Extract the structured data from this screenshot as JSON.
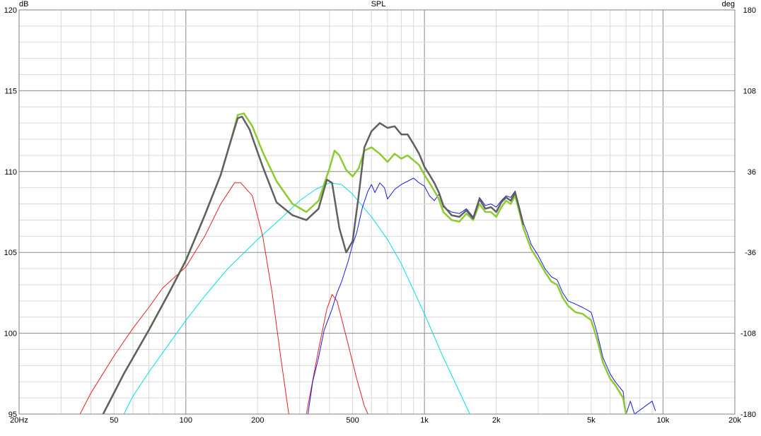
{
  "chart_data": {
    "type": "line",
    "title": "SPL",
    "ylabel_left": "dB",
    "ylabel_right": "deg",
    "x_scale": "log",
    "xlim": [
      20,
      20000
    ],
    "ylim": [
      95,
      120
    ],
    "y2lim": [
      -180,
      180
    ],
    "grid": true,
    "x_ticks": [
      {
        "v": 20,
        "label": "20Hz"
      },
      {
        "v": 50,
        "label": "50"
      },
      {
        "v": 100,
        "label": "100"
      },
      {
        "v": 200,
        "label": "200"
      },
      {
        "v": 500,
        "label": "500"
      },
      {
        "v": 1000,
        "label": "1k"
      },
      {
        "v": 2000,
        "label": "2k"
      },
      {
        "v": 5000,
        "label": "5k"
      },
      {
        "v": 10000,
        "label": "10k"
      },
      {
        "v": 20000,
        "label": "20k"
      }
    ],
    "y_ticks": [
      {
        "v": 95,
        "label": "95"
      },
      {
        "v": 100,
        "label": "100"
      },
      {
        "v": 105,
        "label": "105"
      },
      {
        "v": 110,
        "label": "110"
      },
      {
        "v": 115,
        "label": "115"
      },
      {
        "v": 120,
        "label": "120"
      }
    ],
    "y2_ticks": [
      {
        "v": -180,
        "label": "-180"
      },
      {
        "v": -108,
        "label": "-108"
      },
      {
        "v": -36,
        "label": "-36"
      },
      {
        "v": 36,
        "label": "36"
      },
      {
        "v": 108,
        "label": "108"
      },
      {
        "v": 180,
        "label": "180"
      }
    ],
    "series": [
      {
        "color": "#00e0e8",
        "width": 1,
        "points": [
          [
            55,
            95
          ],
          [
            60,
            96.1
          ],
          [
            70,
            97.6
          ],
          [
            80,
            98.8
          ],
          [
            100,
            100.8
          ],
          [
            120,
            102.3
          ],
          [
            150,
            104
          ],
          [
            200,
            105.8
          ],
          [
            250,
            107.1
          ],
          [
            300,
            108.2
          ],
          [
            350,
            108.9
          ],
          [
            400,
            109.3
          ],
          [
            450,
            109.2
          ],
          [
            500,
            108.6
          ],
          [
            600,
            107.2
          ],
          [
            700,
            105.8
          ],
          [
            800,
            104.3
          ],
          [
            1000,
            101.2
          ],
          [
            1200,
            98.5
          ],
          [
            1400,
            96.4
          ],
          [
            1550,
            95
          ]
        ]
      },
      {
        "color": "#e82020",
        "width": 1,
        "points": [
          [
            36,
            95
          ],
          [
            40,
            96.3
          ],
          [
            50,
            98.6
          ],
          [
            60,
            100.3
          ],
          [
            70,
            101.6
          ],
          [
            80,
            102.8
          ],
          [
            100,
            104.1
          ],
          [
            120,
            106
          ],
          [
            140,
            108
          ],
          [
            160,
            109.3
          ],
          [
            170,
            109.3
          ],
          [
            190,
            108.5
          ],
          [
            210,
            106
          ],
          [
            230,
            102.5
          ],
          [
            250,
            98.5
          ],
          [
            270,
            95
          ]
        ]
      },
      {
        "color": "#e82020",
        "width": 1,
        "points": [
          [
            320,
            95
          ],
          [
            360,
            99
          ],
          [
            390,
            101.5
          ],
          [
            410,
            102.4
          ],
          [
            430,
            102
          ],
          [
            470,
            99.8
          ],
          [
            520,
            97.2
          ],
          [
            560,
            95.5
          ],
          [
            580,
            95
          ]
        ]
      },
      {
        "color": "#1a1ae0",
        "width": 1,
        "points": [
          [
            325,
            95
          ],
          [
            340,
            97
          ],
          [
            360,
            98.5
          ],
          [
            380,
            100.2
          ],
          [
            410,
            101.5
          ],
          [
            430,
            102.5
          ],
          [
            450,
            103.2
          ],
          [
            480,
            104.5
          ],
          [
            500,
            105.5
          ],
          [
            520,
            106.2
          ],
          [
            550,
            107.8
          ],
          [
            580,
            108.8
          ],
          [
            600,
            109.2
          ],
          [
            620,
            108.7
          ],
          [
            650,
            109.3
          ],
          [
            680,
            109
          ],
          [
            700,
            108.3
          ],
          [
            750,
            108.9
          ],
          [
            800,
            109.2
          ],
          [
            850,
            109.4
          ],
          [
            900,
            109.6
          ],
          [
            950,
            109.3
          ],
          [
            1000,
            109.1
          ],
          [
            1050,
            108.5
          ],
          [
            1100,
            108.2
          ],
          [
            1150,
            108.6
          ],
          [
            1200,
            107.8
          ],
          [
            1300,
            107.5
          ],
          [
            1400,
            107.4
          ],
          [
            1500,
            107.7
          ],
          [
            1600,
            107.2
          ],
          [
            1700,
            108.4
          ],
          [
            1800,
            107.9
          ],
          [
            1900,
            108
          ],
          [
            2000,
            107.8
          ],
          [
            2100,
            108.2
          ],
          [
            2200,
            108.5
          ],
          [
            2300,
            108.4
          ],
          [
            2400,
            108.8
          ],
          [
            2500,
            107.8
          ],
          [
            2600,
            106.8
          ],
          [
            2700,
            106.2
          ],
          [
            2800,
            105.5
          ],
          [
            3000,
            104.8
          ],
          [
            3200,
            104
          ],
          [
            3400,
            103.5
          ],
          [
            3600,
            103.3
          ],
          [
            3800,
            102.5
          ],
          [
            4000,
            102
          ],
          [
            4300,
            101.8
          ],
          [
            4600,
            101.6
          ],
          [
            5000,
            101.3
          ],
          [
            5300,
            100
          ],
          [
            5600,
            98.5
          ],
          [
            6000,
            97.5
          ],
          [
            6300,
            97
          ],
          [
            6800,
            96.4
          ],
          [
            7000,
            95
          ],
          [
            7300,
            95.8
          ],
          [
            7600,
            95
          ],
          [
            9000,
            95.8
          ],
          [
            9300,
            95.2
          ]
        ]
      },
      {
        "color": "#8ccc30",
        "width": 2.5,
        "points": [
          [
            45,
            95
          ],
          [
            55,
            97.5
          ],
          [
            70,
            100.2
          ],
          [
            85,
            102.5
          ],
          [
            100,
            104.5
          ],
          [
            120,
            107.3
          ],
          [
            140,
            109.8
          ],
          [
            155,
            112
          ],
          [
            165,
            113.5
          ],
          [
            175,
            113.6
          ],
          [
            190,
            112.8
          ],
          [
            210,
            111.2
          ],
          [
            240,
            109.4
          ],
          [
            280,
            108
          ],
          [
            320,
            107.5
          ],
          [
            360,
            108.2
          ],
          [
            400,
            110.2
          ],
          [
            420,
            111.3
          ],
          [
            440,
            111
          ],
          [
            470,
            110.1
          ],
          [
            500,
            109.7
          ],
          [
            530,
            110.2
          ],
          [
            560,
            111.3
          ],
          [
            600,
            111.5
          ],
          [
            650,
            111.1
          ],
          [
            700,
            110.6
          ],
          [
            750,
            111.1
          ],
          [
            800,
            110.8
          ],
          [
            850,
            111
          ],
          [
            900,
            110.7
          ],
          [
            950,
            110.4
          ],
          [
            1000,
            109.8
          ],
          [
            1050,
            109.3
          ],
          [
            1100,
            108.8
          ],
          [
            1150,
            108.3
          ],
          [
            1200,
            107.5
          ],
          [
            1300,
            107
          ],
          [
            1400,
            106.9
          ],
          [
            1500,
            107.4
          ],
          [
            1600,
            107
          ],
          [
            1700,
            108
          ],
          [
            1800,
            107.5
          ],
          [
            1900,
            107.5
          ],
          [
            2000,
            107.2
          ],
          [
            2100,
            107.8
          ],
          [
            2200,
            108.2
          ],
          [
            2300,
            108
          ],
          [
            2400,
            108.5
          ],
          [
            2500,
            107.5
          ],
          [
            2600,
            106.5
          ],
          [
            2800,
            105.2
          ],
          [
            3000,
            104.5
          ],
          [
            3200,
            103.8
          ],
          [
            3400,
            103.2
          ],
          [
            3600,
            103
          ],
          [
            3800,
            102.2
          ],
          [
            4000,
            101.7
          ],
          [
            4300,
            101.3
          ],
          [
            4600,
            101.2
          ],
          [
            5000,
            100.8
          ],
          [
            5300,
            99.6
          ],
          [
            5600,
            98.2
          ],
          [
            6000,
            97.2
          ],
          [
            6300,
            96.8
          ],
          [
            6800,
            96
          ],
          [
            7000,
            95
          ]
        ]
      },
      {
        "color": "#606060",
        "width": 2.5,
        "points": [
          [
            45,
            95
          ],
          [
            55,
            97.5
          ],
          [
            70,
            100.2
          ],
          [
            85,
            102.5
          ],
          [
            100,
            104.5
          ],
          [
            120,
            107.3
          ],
          [
            140,
            109.8
          ],
          [
            155,
            112
          ],
          [
            165,
            113.3
          ],
          [
            172,
            113.4
          ],
          [
            185,
            112.6
          ],
          [
            210,
            110.3
          ],
          [
            240,
            108.1
          ],
          [
            280,
            107.3
          ],
          [
            320,
            107
          ],
          [
            360,
            107.7
          ],
          [
            390,
            109.5
          ],
          [
            410,
            109.3
          ],
          [
            440,
            106.5
          ],
          [
            470,
            105
          ],
          [
            500,
            105.7
          ],
          [
            530,
            108.5
          ],
          [
            560,
            111.5
          ],
          [
            600,
            112.5
          ],
          [
            650,
            113
          ],
          [
            700,
            112.7
          ],
          [
            750,
            112.8
          ],
          [
            800,
            112.3
          ],
          [
            850,
            112.3
          ],
          [
            900,
            111.7
          ],
          [
            950,
            111.1
          ],
          [
            1000,
            110.3
          ],
          [
            1050,
            109.8
          ],
          [
            1100,
            109.3
          ],
          [
            1150,
            108.7
          ],
          [
            1200,
            107.9
          ],
          [
            1300,
            107.3
          ],
          [
            1400,
            107.2
          ],
          [
            1500,
            107.6
          ],
          [
            1600,
            107.1
          ],
          [
            1700,
            108.3
          ],
          [
            1800,
            107.7
          ],
          [
            1900,
            107.8
          ],
          [
            2000,
            107.5
          ],
          [
            2100,
            108.1
          ],
          [
            2200,
            108.4
          ],
          [
            2300,
            108.2
          ],
          [
            2400,
            108.7
          ],
          [
            2500,
            107.7
          ],
          [
            2600,
            106.7
          ]
        ]
      }
    ]
  }
}
